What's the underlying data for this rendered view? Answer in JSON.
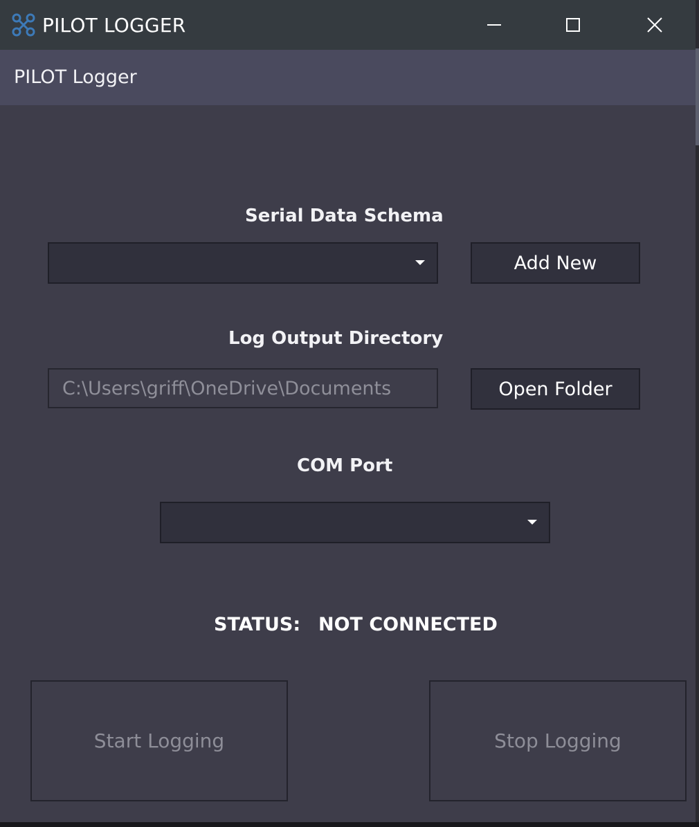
{
  "window": {
    "title": "PILOT LOGGER",
    "app_icon": "drone-icon",
    "controls": {
      "minimize_icon": "minimize-icon",
      "maximize_icon": "maximize-icon",
      "close_icon": "close-icon"
    }
  },
  "header": {
    "title": "PILOT Logger"
  },
  "schema": {
    "label": "Serial Data Schema",
    "selected": "",
    "add_button": "Add New"
  },
  "log_output": {
    "label": "Log Output Directory",
    "path": "C:\\Users\\griff\\OneDrive\\Documents",
    "open_button": "Open Folder"
  },
  "com_port": {
    "label": "COM Port",
    "selected": ""
  },
  "status": {
    "label": "STATUS:",
    "value": "NOT CONNECTED"
  },
  "actions": {
    "start": "Start Logging",
    "stop": "Stop Logging",
    "start_enabled": false,
    "stop_enabled": false
  },
  "colors": {
    "titlebar": "#353b40",
    "header": "#4a4a5e",
    "background": "#3e3d4a",
    "control": "#30303c",
    "icon_accent": "#3d7ab8",
    "disabled_text": "#8e8e98"
  }
}
